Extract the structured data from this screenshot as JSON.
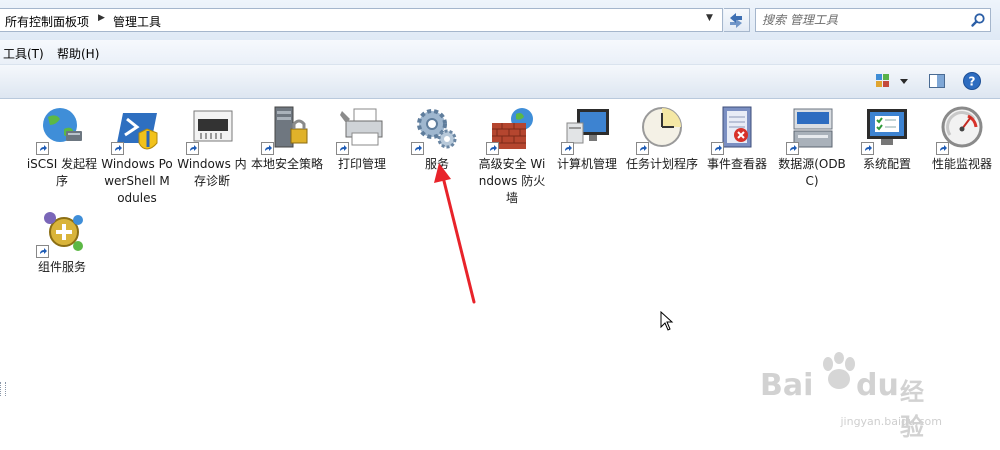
{
  "address": {
    "breadcrumbs": [
      "所有控制面板项",
      "管理工具"
    ]
  },
  "search": {
    "placeholder": "搜索 管理工具"
  },
  "menu": {
    "items": [
      "工具(T)",
      "帮助(H)"
    ]
  },
  "toolbar": {
    "buttons": [
      "change-view",
      "preview-pane",
      "help"
    ]
  },
  "items": [
    {
      "label": "iSCSI 发起程序",
      "icon": "globe-network-icon"
    },
    {
      "label": "Windows PowerShell Modules",
      "icon": "powershell-icon"
    },
    {
      "label": "Windows 内存诊断",
      "icon": "memory-chip-icon"
    },
    {
      "label": "本地安全策略",
      "icon": "server-lock-icon"
    },
    {
      "label": "打印管理",
      "icon": "printer-icon"
    },
    {
      "label": "服务",
      "icon": "gears-icon"
    },
    {
      "label": "高级安全 Windows 防火墙",
      "icon": "firewall-icon"
    },
    {
      "label": "计算机管理",
      "icon": "computer-management-icon"
    },
    {
      "label": "任务计划程序",
      "icon": "clock-icon"
    },
    {
      "label": "事件查看器",
      "icon": "event-viewer-icon"
    },
    {
      "label": "数据源(ODBC)",
      "icon": "database-icon"
    },
    {
      "label": "系统配置",
      "icon": "system-config-icon"
    },
    {
      "label": "性能监视器",
      "icon": "gauge-icon"
    },
    {
      "label": "组件服务",
      "icon": "component-services-icon"
    }
  ],
  "watermark": {
    "brand": "Bai",
    "brand_tail": "du",
    "cn": "经验",
    "url": "jingyan.baidu.com"
  },
  "colors": {
    "annotation_arrow": "#e8232a",
    "chrome": "#dfe9f5"
  }
}
